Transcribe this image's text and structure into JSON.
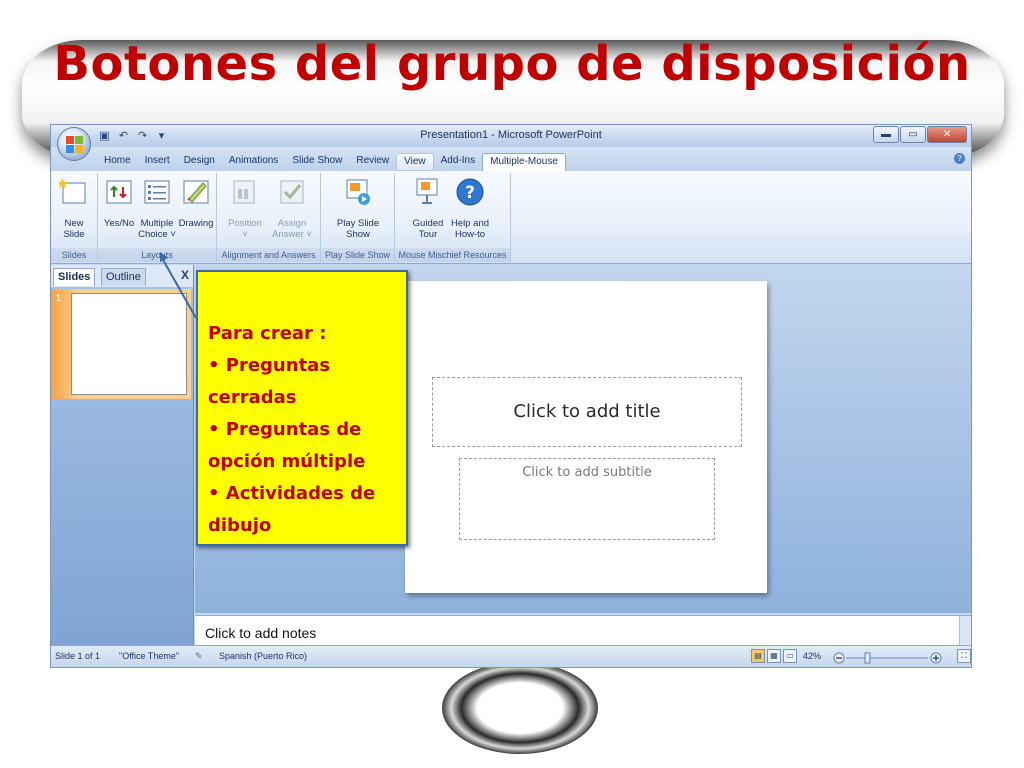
{
  "slide": {
    "title": "Botones del grupo de disposición"
  },
  "window": {
    "title": "Presentation1 - Microsoft PowerPoint",
    "controls": {
      "minimize": "▬",
      "maximize": "▭",
      "close": "✕"
    }
  },
  "ribbon": {
    "tabs": [
      {
        "label": "Home"
      },
      {
        "label": "Insert"
      },
      {
        "label": "Design"
      },
      {
        "label": "Animations"
      },
      {
        "label": "Slide Show"
      },
      {
        "label": "Review"
      },
      {
        "label": "View"
      },
      {
        "label": "Add-Ins"
      },
      {
        "label": "Multiple-Mouse"
      }
    ],
    "groups": {
      "slides": {
        "label": "Slides",
        "new_slide": {
          "line1": "New",
          "line2": "Slide"
        }
      },
      "layouts": {
        "label": "Layouts",
        "yes_no": {
          "line1": "Yes/No"
        },
        "multiple_choice": {
          "line1": "Multiple",
          "line2": "Choice ˅"
        },
        "drawing": {
          "line1": "Drawing"
        }
      },
      "alignment": {
        "label": "Alignment and Answers",
        "position": {
          "line1": "Position",
          "line2": "˅"
        },
        "assign_answer": {
          "line1": "Assign",
          "line2": "Answer ˅"
        }
      },
      "play_slide_show": {
        "label": "Play Slide Show",
        "play": {
          "line1": "Play Slide",
          "line2": "Show"
        }
      },
      "resources": {
        "label": "Mouse Mischief Resources",
        "guided_tour": {
          "line1": "Guided",
          "line2": "Tour"
        },
        "help": {
          "line1": "Help and",
          "line2": "How-to"
        }
      }
    }
  },
  "panel": {
    "tab_slides": "Slides",
    "tab_outline": "Outline",
    "close": "X",
    "slide_number": "1"
  },
  "canvas": {
    "title_placeholder": "Click to add title",
    "subtitle_placeholder": "Click to add subtitle"
  },
  "notes": {
    "placeholder": "Click to add notes"
  },
  "status": {
    "slide_count": "Slide 1 of 1",
    "theme": "\"Office Theme\"",
    "language": "Spanish (Puerto Rico)",
    "zoom": "42%"
  },
  "callout": {
    "heading": "Para  crear :",
    "items": [
      "• Preguntas cerradas",
      "• Preguntas de opción múltiple",
      "• Actividades de dibujo"
    ]
  },
  "colors": {
    "title_red": "#c00000",
    "callout_yellow": "#ffff00",
    "ribbon_blue": "#c5d8ee"
  }
}
